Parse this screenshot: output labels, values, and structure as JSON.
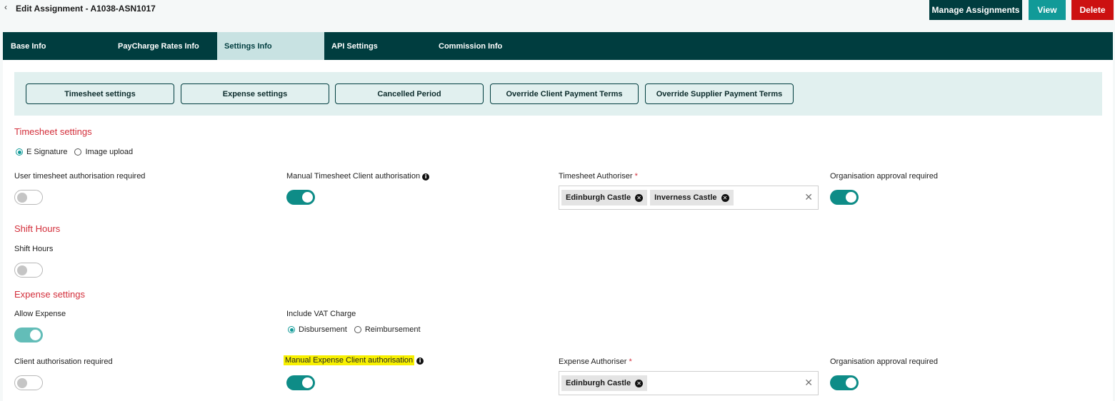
{
  "header": {
    "back_glyph": "‹",
    "title": "Edit Assignment - A1038-ASN1017",
    "buttons": {
      "manage": "Manage Assignments",
      "view": "View",
      "delete": "Delete"
    }
  },
  "tabs": [
    "Base Info",
    "PayCharge Rates Info",
    "Settings Info",
    "API Settings",
    "Commission Info"
  ],
  "active_tab": "Settings Info",
  "subnav": [
    "Timesheet settings",
    "Expense settings",
    "Cancelled Period",
    "Override Client Payment Terms",
    "Override Supplier Payment Terms"
  ],
  "timesheet": {
    "title": "Timesheet settings",
    "sig_options": [
      "E Signature",
      "Image upload"
    ],
    "sig_selected": "E Signature",
    "user_auth_label": "User timesheet authorisation required",
    "user_auth_on": false,
    "manual_client_label": "Manual Timesheet Client authorisation",
    "manual_client_on": true,
    "authoriser_label": "Timesheet Authoriser",
    "required_mark": "*",
    "authorisers": [
      "Edinburgh Castle",
      "Inverness Castle"
    ],
    "org_approval_label": "Organisation approval required",
    "org_approval_on": true
  },
  "shift": {
    "title": "Shift Hours",
    "label": "Shift Hours",
    "on": false
  },
  "expense": {
    "title": "Expense settings",
    "allow_label": "Allow Expense",
    "allow_on": true,
    "vat_label": "Include VAT Charge",
    "vat_options": [
      "Disbursement",
      "Reimbursement"
    ],
    "vat_selected": "Disbursement",
    "client_auth_label": "Client authorisation required",
    "client_auth_on": false,
    "manual_client_label": "Manual Expense Client authorisation",
    "manual_client_on": true,
    "authoriser_label": "Expense Authoriser",
    "required_mark": "*",
    "authorisers": [
      "Edinburgh Castle"
    ],
    "org_approval_label": "Organisation approval required",
    "org_approval_on": true
  },
  "icons": {
    "info": "i",
    "chip_remove": "✕",
    "clear": "✕"
  },
  "colors": {
    "dark_teal": "#003d3f",
    "accent_teal": "#119a98",
    "delete_red": "#cc1111",
    "section_red": "#d32f3b",
    "highlight_yellow": "#f7f000"
  }
}
